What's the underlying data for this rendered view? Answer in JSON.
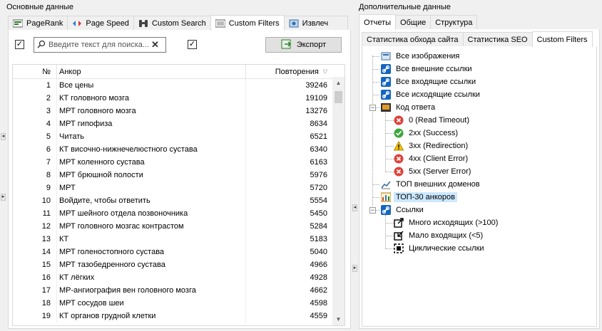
{
  "left": {
    "section_label": "Основные данные",
    "tabs": [
      {
        "label": "PageRank",
        "icon": "pagerank-icon"
      },
      {
        "label": "Page Speed",
        "icon": "page-speed-icon"
      },
      {
        "label": "Custom Search",
        "icon": "binoculars-icon"
      },
      {
        "label": "Custom Filters",
        "icon": "filter-icon"
      },
      {
        "label": "Извлеч",
        "icon": "extract-icon"
      }
    ],
    "search_placeholder": "Введите текст для поиска...",
    "export_label": "Экспорт",
    "table": {
      "headers": {
        "num": "№",
        "anchor": "Анкор",
        "reps": "Повторения"
      },
      "rows": [
        {
          "num": "1",
          "anchor": "Все цены",
          "reps": "39246"
        },
        {
          "num": "2",
          "anchor": "КТ головного мозга",
          "reps": "19109"
        },
        {
          "num": "3",
          "anchor": "МРТ головного мозга",
          "reps": "13276"
        },
        {
          "num": "4",
          "anchor": "МРТ гипофиза",
          "reps": "8634"
        },
        {
          "num": "5",
          "anchor": "Читать",
          "reps": "6521"
        },
        {
          "num": "6",
          "anchor": "КТ височно-нижнечелюстного сустава",
          "reps": "6340"
        },
        {
          "num": "7",
          "anchor": "МРТ коленного сустава",
          "reps": "6163"
        },
        {
          "num": "8",
          "anchor": "МРТ брюшной полости",
          "reps": "5976"
        },
        {
          "num": "9",
          "anchor": "МРТ",
          "reps": "5720"
        },
        {
          "num": "10",
          "anchor": "Войдите, чтобы ответить",
          "reps": "5554"
        },
        {
          "num": "11",
          "anchor": "МРТ шейного отдела позвоночника",
          "reps": "5450"
        },
        {
          "num": "12",
          "anchor": "МРТ головного мозгас контрастом",
          "reps": "5284"
        },
        {
          "num": "13",
          "anchor": "КТ",
          "reps": "5183"
        },
        {
          "num": "14",
          "anchor": "МРТ голеностопного сустава",
          "reps": "5040"
        },
        {
          "num": "15",
          "anchor": "МРТ тазобедренного сустава",
          "reps": "4966"
        },
        {
          "num": "16",
          "anchor": "КТ лёгких",
          "reps": "4928"
        },
        {
          "num": "17",
          "anchor": "МР-ангиография вен головного мозга",
          "reps": "4662"
        },
        {
          "num": "18",
          "anchor": "МРТ сосудов шеи",
          "reps": "4598"
        },
        {
          "num": "19",
          "anchor": "КТ органов грудной клетки",
          "reps": "4559"
        }
      ]
    }
  },
  "right": {
    "section_label": "Дополнительные данные",
    "tabs": [
      "Отчеты",
      "Общие",
      "Структура"
    ],
    "subtabs": [
      "Статистика обхода сайта",
      "Статистика SEO",
      "Custom Filters"
    ],
    "tree": [
      {
        "label": "Все изображения",
        "icon": "images-icon"
      },
      {
        "label": "Все внешние ссылки",
        "icon": "link-icon"
      },
      {
        "label": "Все входящие ссылки",
        "icon": "link-icon"
      },
      {
        "label": "Все исходящие ссылки",
        "icon": "link-icon"
      },
      {
        "label": "Код ответа",
        "icon": "response-code-icon"
      },
      {
        "label": "0 (Read Timeout)",
        "icon": "error-icon"
      },
      {
        "label": "2xx (Success)",
        "icon": "success-icon"
      },
      {
        "label": "3xx (Redirection)",
        "icon": "warning-icon"
      },
      {
        "label": "4xx (Client Error)",
        "icon": "error-icon"
      },
      {
        "label": "5xx (Server Error)",
        "icon": "error-icon"
      },
      {
        "label": "ТОП внешних доменов",
        "icon": "chart-icon"
      },
      {
        "label": "ТОП-30 анкоров",
        "icon": "chart-bar-icon"
      },
      {
        "label": "Ссылки",
        "icon": "link-icon"
      },
      {
        "label": "Много исходящих (>100)",
        "icon": "outgoing-icon"
      },
      {
        "label": "Мало входящих (<5)",
        "icon": "incoming-icon"
      },
      {
        "label": "Циклические ссылки",
        "icon": "cycle-icon"
      }
    ]
  },
  "colors": {
    "accent": "#0f6fc6",
    "selection": "#cce8ff",
    "error": "#e0403a",
    "success": "#3aa63a",
    "warning": "#f2c200"
  }
}
